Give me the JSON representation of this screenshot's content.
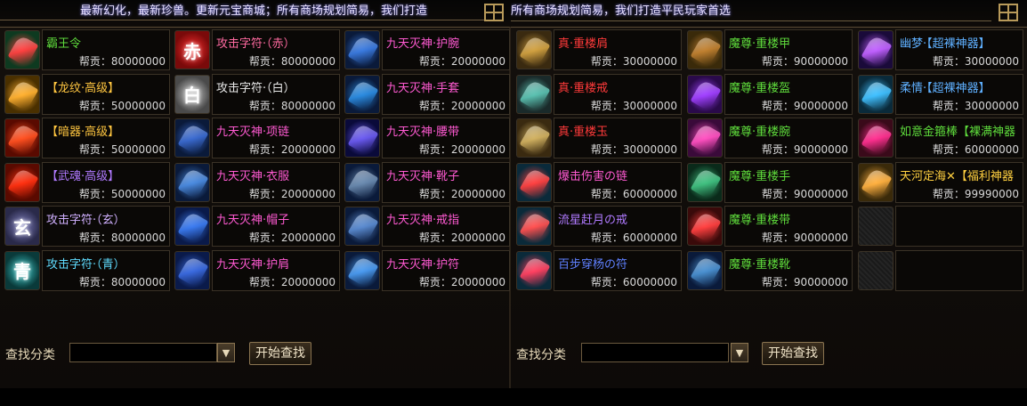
{
  "marquee": {
    "left": "最新幻化，最新珍兽。更新元宝商城；所有商场规划简易，我们打造",
    "right": "所有商场规划简易，我们打造平民玩家首选"
  },
  "price_label": "帮贡：",
  "left_items": [
    {
      "name": "霸王令",
      "price": "80000000",
      "color": "#5fdc3c",
      "icon": "orb-icon",
      "bg": "#0e3a20",
      "accent": "#ff4040"
    },
    {
      "name": "攻击字符·（赤）",
      "price": "80000000",
      "color": "#ff6aa0",
      "icon": "red-rune-icon",
      "bg": "#7a0a0a",
      "accent": "#ff3030",
      "glyph": "赤"
    },
    {
      "name": "九天灭神·护腕",
      "price": "20000000",
      "color": "#ff5ad2",
      "icon": "bracer-icon",
      "bg": "#0a1a3a",
      "accent": "#3a7adf"
    },
    {
      "name": "【龙纹·高级】",
      "price": "50000000",
      "color": "#ffc640",
      "icon": "dragon-icon",
      "bg": "#4a3000",
      "accent": "#ffb030"
    },
    {
      "name": "攻击字符·（白）",
      "price": "80000000",
      "color": "#e8e8e8",
      "icon": "white-rune-icon",
      "bg": "#4a4a4a",
      "accent": "#d0d0d0",
      "glyph": "白"
    },
    {
      "name": "九天灭神·手套",
      "price": "20000000",
      "color": "#ff5ad2",
      "icon": "glove-icon",
      "bg": "#0a1a3a",
      "accent": "#2a8adf"
    },
    {
      "name": "【暗器·高级】",
      "price": "50000000",
      "color": "#ffc640",
      "icon": "hidden-weapon-icon",
      "bg": "#5a0a00",
      "accent": "#ff5020"
    },
    {
      "name": "九天灭神·项链",
      "price": "20000000",
      "color": "#ff5ad2",
      "icon": "necklace-icon",
      "bg": "#0a1a3a",
      "accent": "#3a6acf"
    },
    {
      "name": "九天灭神·腰带",
      "price": "20000000",
      "color": "#ff5ad2",
      "icon": "belt-icon",
      "bg": "#0a0a3a",
      "accent": "#6a5aef"
    },
    {
      "name": "【武魂·高级】",
      "price": "50000000",
      "color": "#b07aff",
      "icon": "soul-icon",
      "bg": "#5a0a00",
      "accent": "#ff3010"
    },
    {
      "name": "九天灭神·衣服",
      "price": "20000000",
      "color": "#ff5ad2",
      "icon": "armor-icon",
      "bg": "#0a1a3a",
      "accent": "#4a8adf"
    },
    {
      "name": "九天灭神·靴子",
      "price": "20000000",
      "color": "#ff5ad2",
      "icon": "boots-icon",
      "bg": "#0a1a3a",
      "accent": "#6a8aaf"
    },
    {
      "name": "攻击字符·（玄）",
      "price": "80000000",
      "color": "#d0b0ff",
      "icon": "dark-rune-icon",
      "bg": "#2a2a4a",
      "accent": "#8080c0",
      "glyph": "玄"
    },
    {
      "name": "九天灭神·帽子",
      "price": "20000000",
      "color": "#ff5ad2",
      "icon": "hat-icon",
      "bg": "#0a1a4a",
      "accent": "#3a7aef"
    },
    {
      "name": "九天灭神·戒指",
      "price": "20000000",
      "color": "#ff5ad2",
      "icon": "ring-icon",
      "bg": "#0a1a3a",
      "accent": "#5a8acf"
    },
    {
      "name": "攻击字符·（青）",
      "price": "80000000",
      "color": "#5fdcff",
      "icon": "cyan-rune-icon",
      "bg": "#0a3a3a",
      "accent": "#40d0d0",
      "glyph": "青"
    },
    {
      "name": "九天灭神·护肩",
      "price": "20000000",
      "color": "#ff5ad2",
      "icon": "shoulder-icon",
      "bg": "#0a1a4a",
      "accent": "#3a6adf"
    },
    {
      "name": "九天灭神·护符",
      "price": "20000000",
      "color": "#ff5ad2",
      "icon": "amulet-icon",
      "bg": "#0a1a3a",
      "accent": "#4a9aef"
    }
  ],
  "right_items": [
    {
      "name": "真·重楼肩",
      "price": "30000000",
      "color": "#ff3a3a",
      "icon": "pauldron-icon",
      "bg": "#3a2a10",
      "accent": "#d0a040"
    },
    {
      "name": "魔尊·重楼甲",
      "price": "90000000",
      "color": "#5fdc3c",
      "icon": "chest-icon",
      "bg": "#3a2a0a",
      "accent": "#c08030"
    },
    {
      "name": "幽梦·【超裸神器】",
      "price": "30000000",
      "color": "#5fb0ff",
      "icon": "spear-icon",
      "bg": "#1a0a3a",
      "accent": "#c060ff"
    },
    {
      "name": "真·重楼戒",
      "price": "30000000",
      "color": "#ff3a3a",
      "icon": "ring-icon",
      "bg": "#1a2a2a",
      "accent": "#5ac0b0"
    },
    {
      "name": "魔尊·重楼盔",
      "price": "90000000",
      "color": "#5fdc3c",
      "icon": "helm-icon",
      "bg": "#2a0a4a",
      "accent": "#a040ff"
    },
    {
      "name": "柔情·【超裸神器】",
      "price": "30000000",
      "color": "#5fb0ff",
      "icon": "blade-icon",
      "bg": "#0a2a3a",
      "accent": "#40c0ff"
    },
    {
      "name": "真·重楼玉",
      "price": "30000000",
      "color": "#ff3a3a",
      "icon": "jade-icon",
      "bg": "#3a2a10",
      "accent": "#d0b060"
    },
    {
      "name": "魔尊·重楼腕",
      "price": "90000000",
      "color": "#5fdc3c",
      "icon": "wrist-icon",
      "bg": "#3a0a3a",
      "accent": "#ff50c0"
    },
    {
      "name": "如意金箍棒【裸满神器",
      "price": "60000000",
      "color": "#5fdc3c",
      "icon": "staff-icon",
      "bg": "#3a0a1a",
      "accent": "#ff3090"
    },
    {
      "name": "爆击伤害の链",
      "price": "60000000",
      "color": "#ff5ad2",
      "icon": "chain-icon",
      "bg": "#0a2a3a",
      "accent": "#ff4040"
    },
    {
      "name": "魔尊·重楼手",
      "price": "90000000",
      "color": "#5fdc3c",
      "icon": "hand-icon",
      "bg": "#0a2a1a",
      "accent": "#40c080"
    },
    {
      "name": "天河定海✕【福利神器",
      "price": "99990000",
      "color": "#ffd040",
      "icon": "trident-icon",
      "bg": "#3a2a0a",
      "accent": "#ffb040"
    },
    {
      "name": "流星赶月の戒",
      "price": "60000000",
      "color": "#b07aff",
      "icon": "ring-icon",
      "bg": "#0a2a3a",
      "accent": "#ff5050"
    },
    {
      "name": "魔尊·重楼带",
      "price": "90000000",
      "color": "#5fdc3c",
      "icon": "belt-icon",
      "bg": "#3a0a0a",
      "accent": "#ff4040"
    },
    null,
    {
      "name": "百步穿杨の符",
      "price": "60000000",
      "color": "#5f80ff",
      "icon": "amulet-icon",
      "bg": "#0a2a3a",
      "accent": "#ff4060"
    },
    {
      "name": "魔尊·重楼靴",
      "price": "90000000",
      "color": "#5fdc3c",
      "icon": "boots-icon",
      "bg": "#0a1a3a",
      "accent": "#4a90d0"
    },
    null
  ],
  "search": {
    "label": "查找分类",
    "value": "",
    "button": "开始查找"
  }
}
